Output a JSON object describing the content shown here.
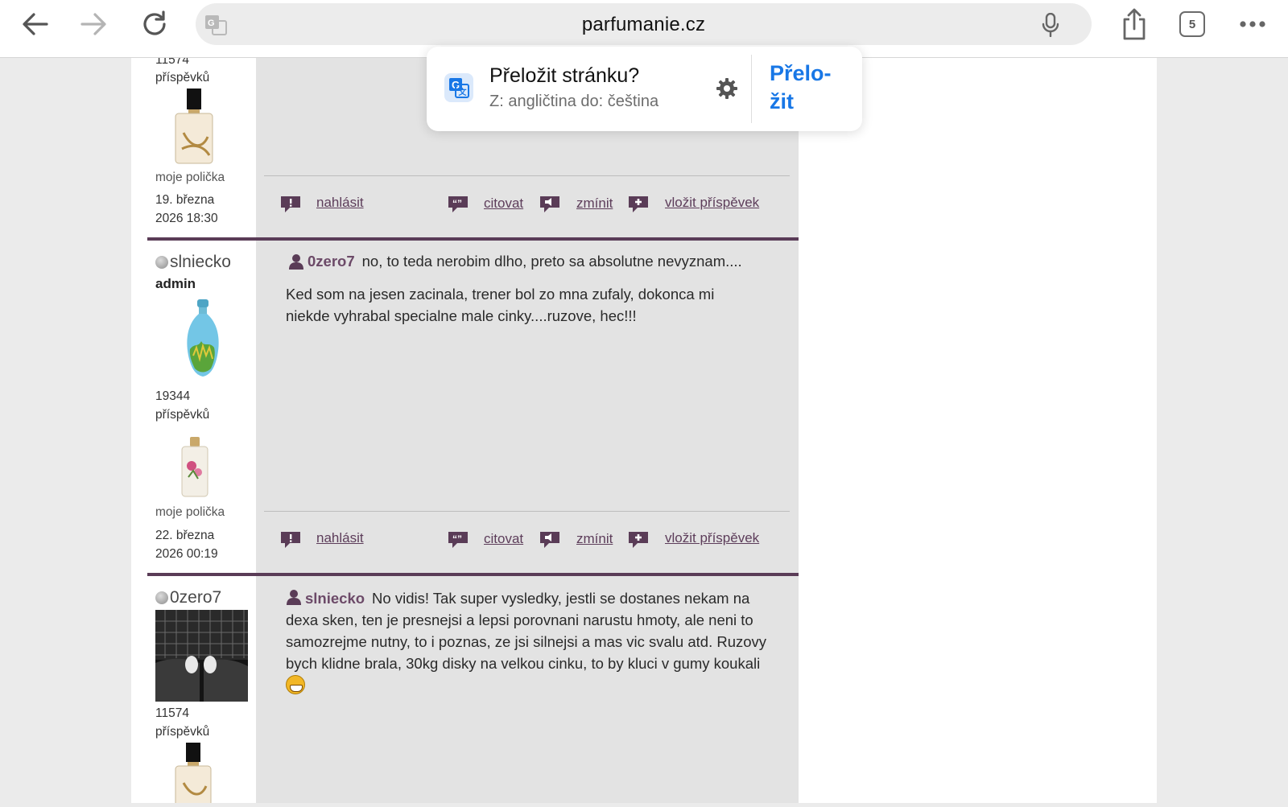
{
  "browser": {
    "url": "parfumanie.cz",
    "tab_count": "5"
  },
  "translate_popup": {
    "title": "Přeložit stránku?",
    "subtitle": "Z: angličtina do: čeština",
    "button_line1": "Přelo-",
    "button_line2": "žit"
  },
  "post_top": {
    "user_post_count": "11574",
    "posts_label": "příspěvků",
    "shelf_label": "moje polička",
    "date_line1": "19. března",
    "date_line2": "2026 18:30"
  },
  "actions": {
    "report": "nahlásit",
    "quote": "citovat",
    "mention": "zmínit",
    "add_post": "vložit příspěvek"
  },
  "post_slniecko": {
    "username": "slniecko",
    "role": "admin",
    "post_count": "19344",
    "posts_label": "příspěvků",
    "shelf_label": "moje polička",
    "date_line1": "22. března",
    "date_line2": "2026 00:19",
    "quoted_user": "0zero7",
    "quoted_text": "no, to teda nerobim dlho, preto sa absolutne nevyznam....",
    "text": "Ked som na jesen zacinala, trener bol zo mna zufaly, dokonca mi niekde vyhrabal specialne male cinky....ruzove, hec!!!"
  },
  "post_0zero7": {
    "username": "0zero7",
    "post_count": "11574",
    "posts_label": "příspěvků",
    "quoted_user": "slniecko",
    "text": "No vidis! Tak super vysledky, jestli se dostanes nekam na dexa sken, ten je presnejsi a lepsi porovnani narustu hmoty, ale neni to samozrejme nutny, to i poznas, ze jsi silnejsi a mas vic svalu atd. Ruzovy bych klidne brala, 30kg disky na velkou cinku, to by kluci v gumy koukali",
    "emoji": "grimacing-face-emoji"
  },
  "colors": {
    "accent_purple": "#5a3c57",
    "link_blue": "#1877e6"
  }
}
